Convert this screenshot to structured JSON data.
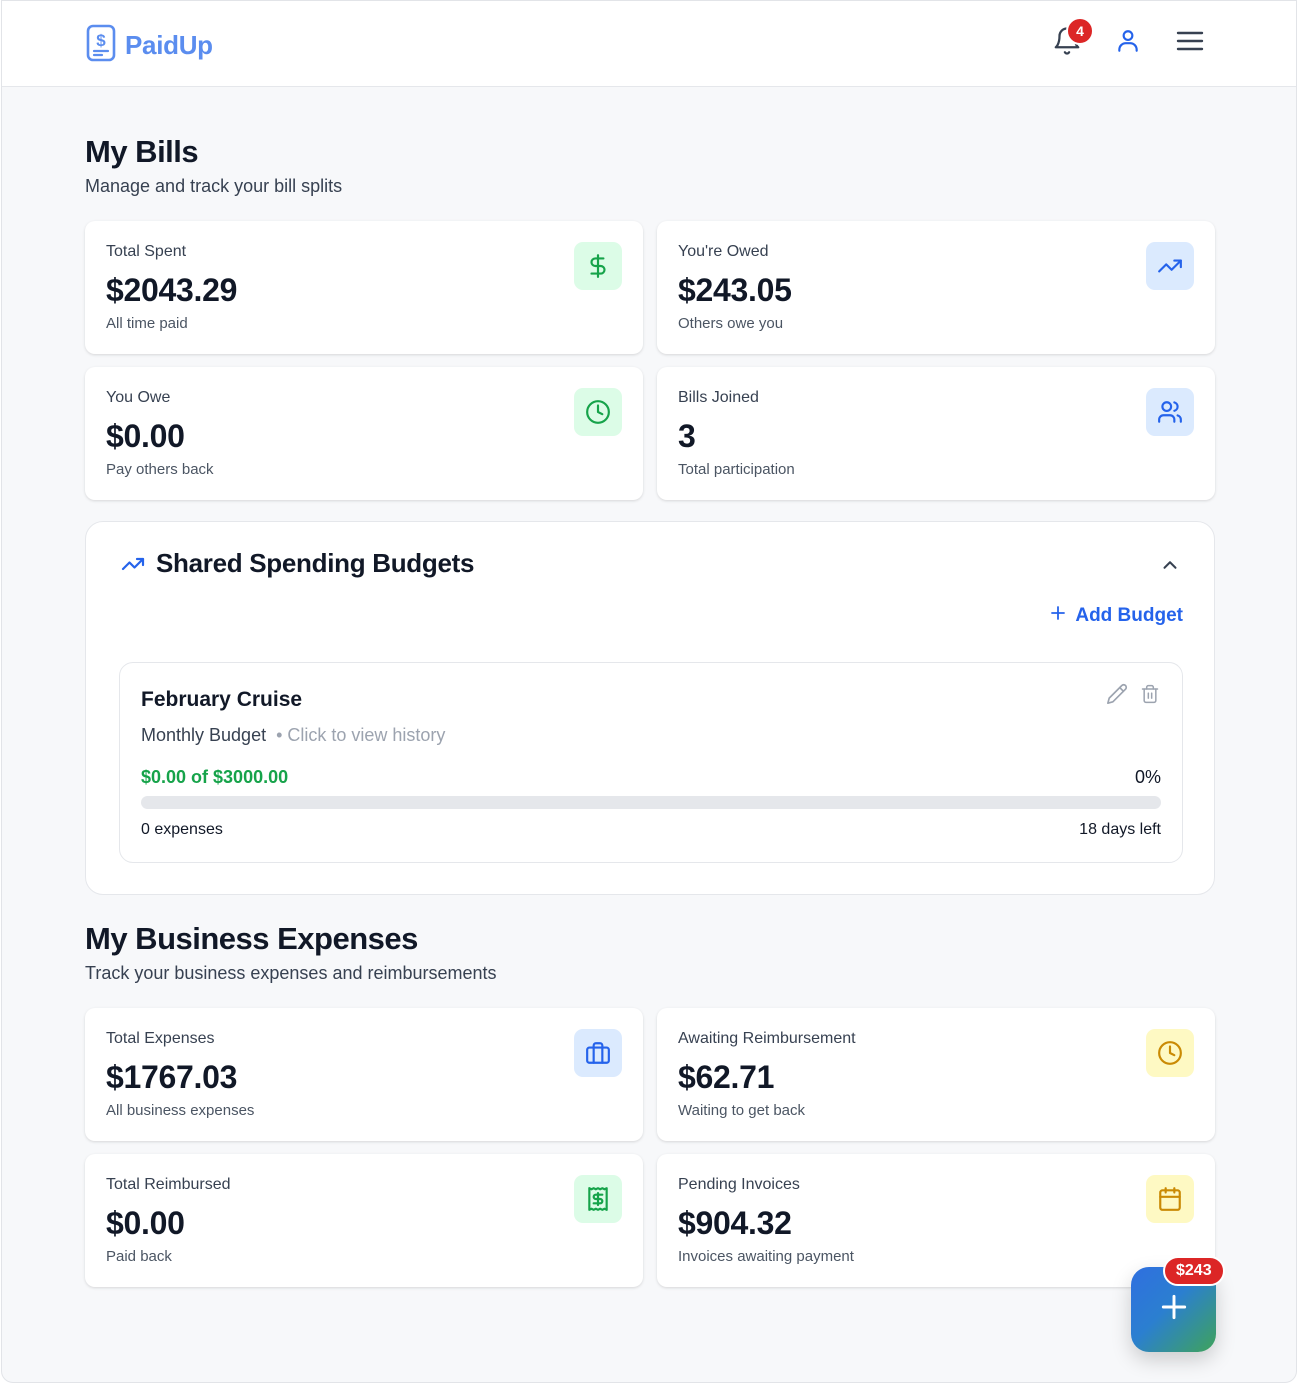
{
  "app": {
    "name": "PaidUp",
    "notification_count": "4"
  },
  "bills": {
    "title": "My Bills",
    "subtitle": "Manage and track your bill splits",
    "cards": [
      {
        "label": "Total Spent",
        "value": "$2043.29",
        "note": "All time paid",
        "icon": "dollar-icon",
        "color": "#16a34a"
      },
      {
        "label": "You're Owed",
        "value": "$243.05",
        "note": "Others owe you",
        "icon": "trending-up-icon",
        "color": "#2563eb"
      },
      {
        "label": "You Owe",
        "value": "$0.00",
        "note": "Pay others back",
        "icon": "clock-icon",
        "color": "#16a34a"
      },
      {
        "label": "Bills Joined",
        "value": "3",
        "note": "Total participation",
        "icon": "users-icon",
        "color": "#2563eb"
      }
    ]
  },
  "budgets": {
    "title": "Shared Spending Budgets",
    "add_label": "Add Budget",
    "items": [
      {
        "name": "February Cruise",
        "period": "Monthly Budget",
        "history_link": "• Click to view history",
        "amount_text": "$0.00 of $3000.00",
        "percent_text": "0%",
        "progress": 0,
        "expenses_text": "0 expenses",
        "days_left_text": "18 days left"
      }
    ]
  },
  "business": {
    "title": "My Business Expenses",
    "subtitle": "Track your business expenses and reimbursements",
    "cards": [
      {
        "label": "Total Expenses",
        "value": "$1767.03",
        "note": "All business expenses",
        "icon": "briefcase-icon",
        "color": "#2563eb"
      },
      {
        "label": "Awaiting Reimbursement",
        "value": "$62.71",
        "note": "Waiting to get back",
        "icon": "clock-icon",
        "color": "#ca8a04"
      },
      {
        "label": "Total Reimbursed",
        "value": "$0.00",
        "note": "Paid back",
        "icon": "receipt-icon",
        "color": "#16a34a"
      },
      {
        "label": "Pending Invoices",
        "value": "$904.32",
        "note": "Invoices awaiting payment",
        "icon": "calendar-icon",
        "color": "#ca8a04"
      }
    ]
  },
  "fab": {
    "badge": "$243",
    "icon": "plus-icon"
  }
}
